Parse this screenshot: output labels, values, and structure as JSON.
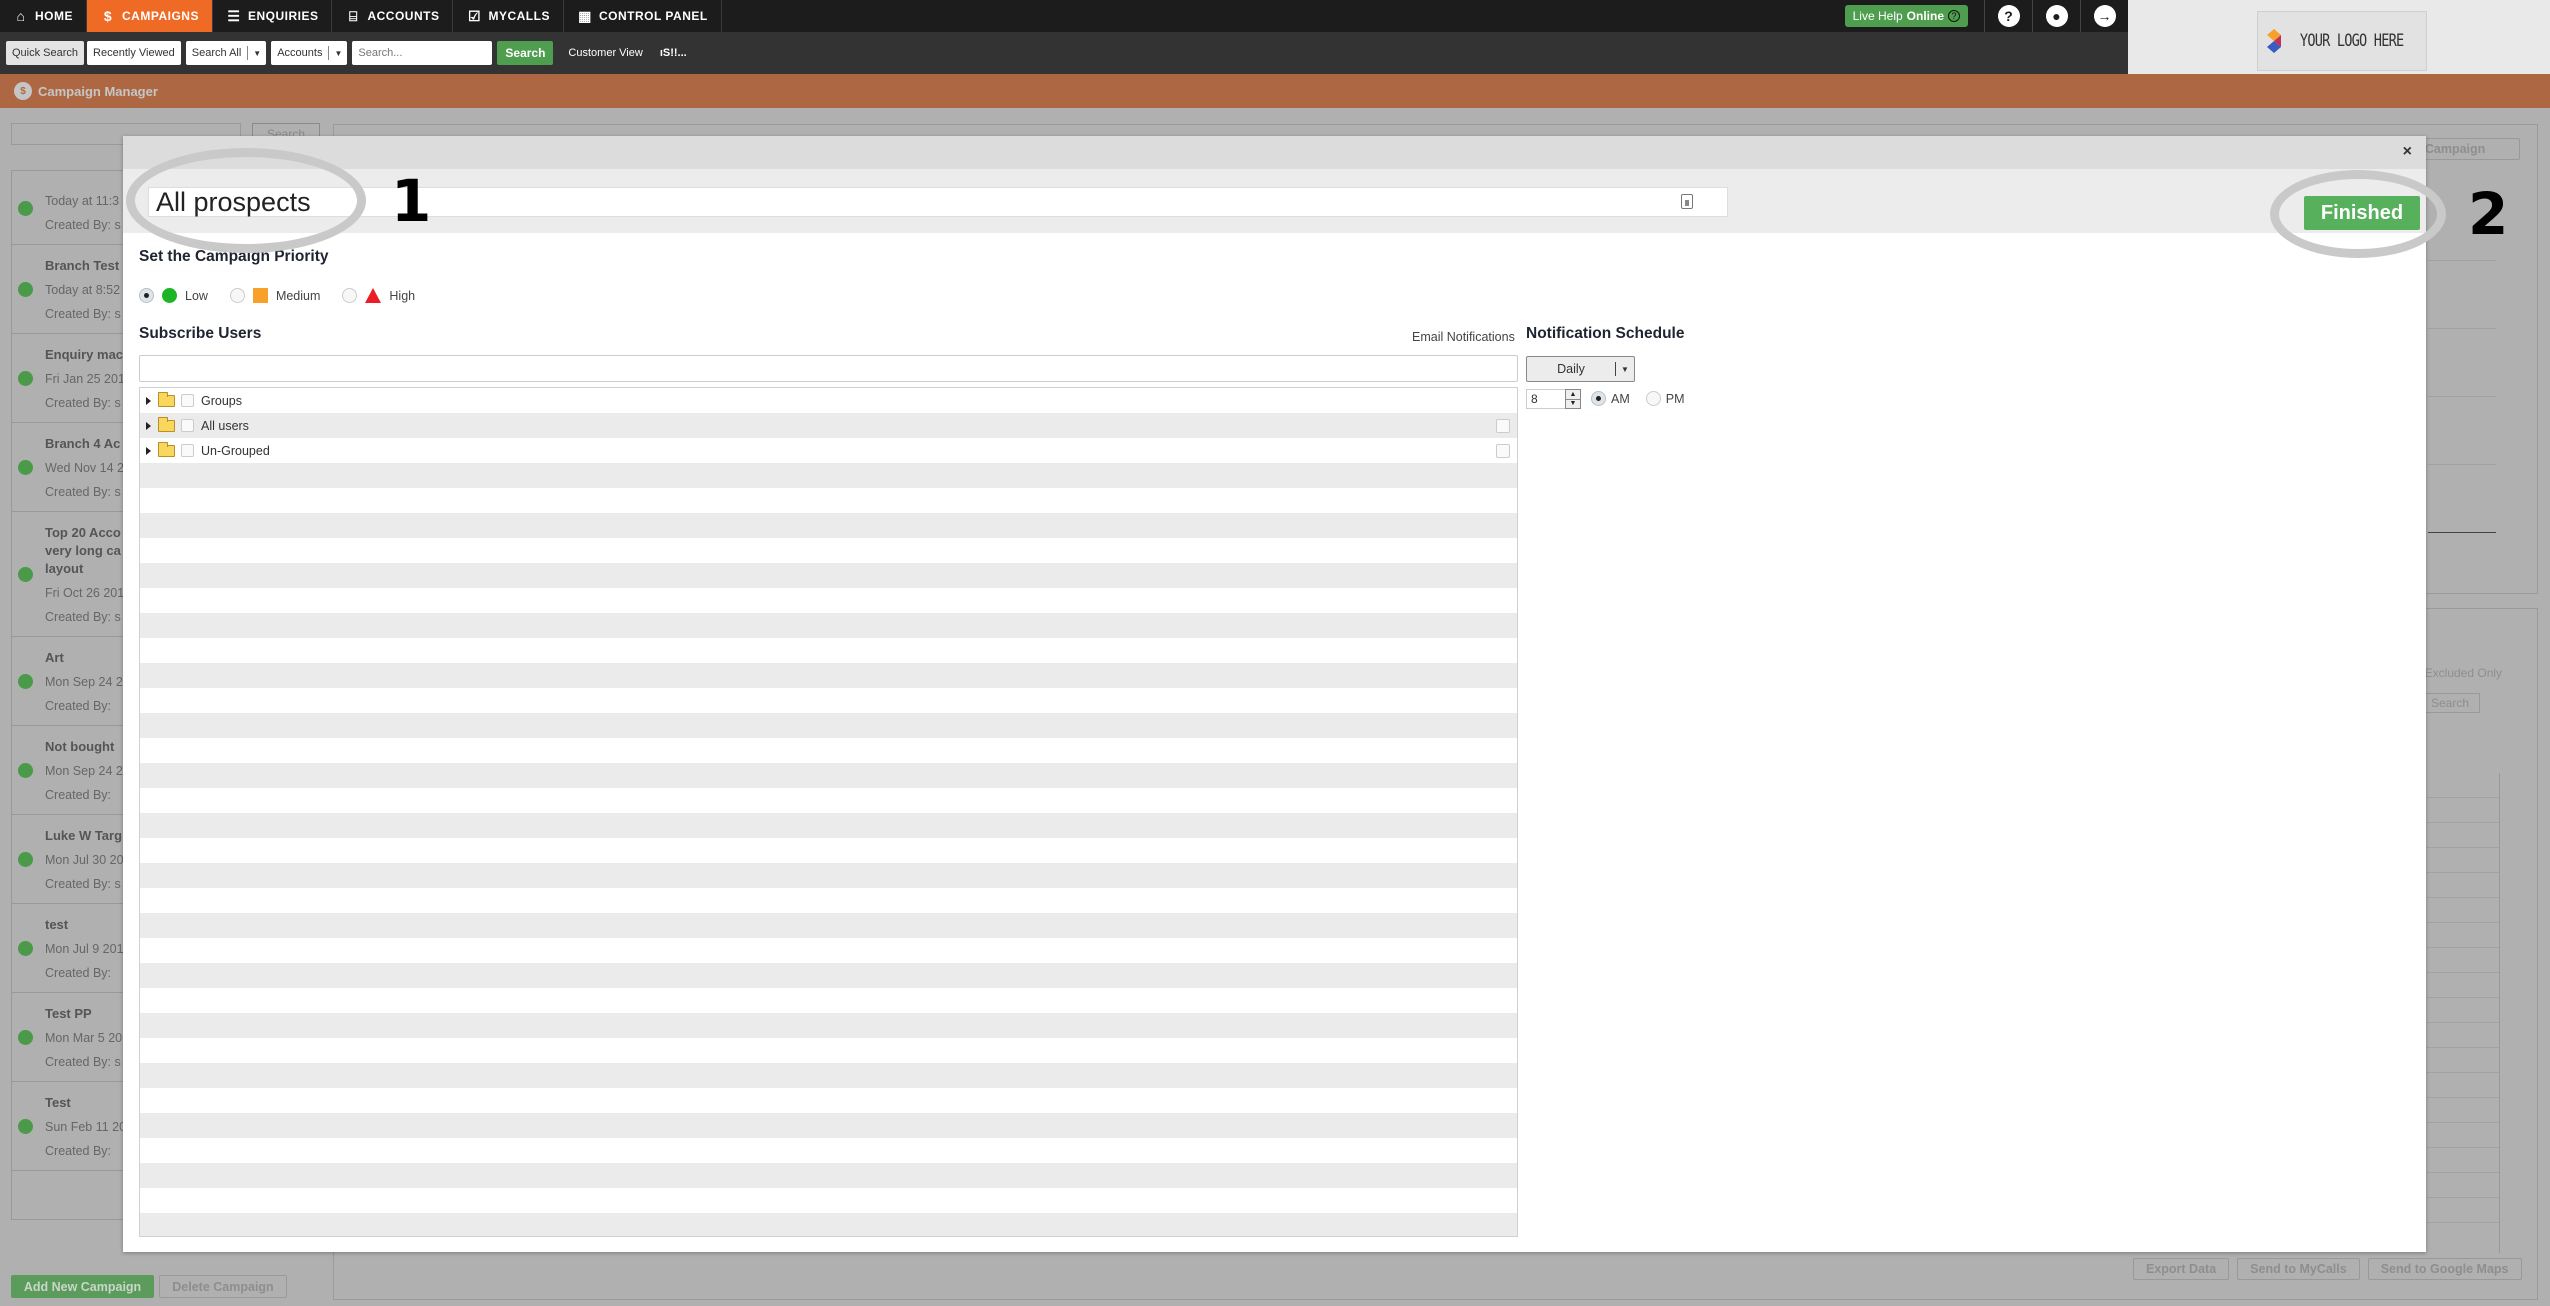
{
  "nav": {
    "items": [
      {
        "label": "HOME",
        "icon": "home-icon",
        "active": false
      },
      {
        "label": "CAMPAIGNS",
        "icon": "campaigns-icon",
        "active": true
      },
      {
        "label": "ENQUIRIES",
        "icon": "enquiries-icon",
        "active": false
      },
      {
        "label": "ACCOUNTS",
        "icon": "accounts-icon",
        "active": false
      },
      {
        "label": "MYCALLS",
        "icon": "mycalls-icon",
        "active": false
      },
      {
        "label": "CONTROL PANEL",
        "icon": "control-panel-icon",
        "active": false
      }
    ],
    "live_help_prefix": "Live Help",
    "live_help_status": "Online",
    "help_icon": "?",
    "user_icon": "user-icon",
    "logout_icon": "→"
  },
  "searchbar": {
    "quick_search": "Quick Search",
    "recently_viewed": "Recently Viewed",
    "scope_select": "Search All",
    "type_select": "Accounts",
    "search_placeholder": "Search...",
    "search_button": "Search",
    "customer_view": "Customer View",
    "extra_link": "ıS!!..."
  },
  "logo": {
    "text": "YOUR LOGO HERE"
  },
  "header": {
    "title": "Campaign Manager"
  },
  "background": {
    "search_button": "Search",
    "campaigns": [
      {
        "name": "",
        "date": "Today at 11:3",
        "created_by": "Created By: s"
      },
      {
        "name": "Branch Test",
        "date": "Today at 8:52",
        "created_by": "Created By: s"
      },
      {
        "name": "Enquiry mac",
        "date": "Fri Jan 25 201",
        "created_by": "Created By: s"
      },
      {
        "name": "Branch 4 Ac",
        "date": "Wed Nov 14 2",
        "created_by": "Created By: s"
      },
      {
        "name": "Top 20 Acco very long ca layout",
        "date": "Fri Oct 26 201",
        "created_by": "Created By: s"
      },
      {
        "name": "Art",
        "date": "Mon Sep 24 2",
        "created_by": "Created By:"
      },
      {
        "name": "Not bought",
        "date": "Mon Sep 24 2",
        "created_by": "Created By:"
      },
      {
        "name": "Luke W Targ",
        "date": "Mon Jul 30 20",
        "created_by": "Created By: s"
      },
      {
        "name": "test",
        "date": "Mon Jul 9 201",
        "created_by": "Created By:"
      },
      {
        "name": "Test PP",
        "date": "Mon Mar 5 20",
        "created_by": "Created By: s"
      },
      {
        "name": "Test",
        "date": "Sun Feb 11 20",
        "created_by": "Created By:"
      }
    ],
    "add_campaign": "Add New Campaign",
    "delete_campaign": "Delete Campaign",
    "new_campaign": "ew Campaign",
    "excluded_only": "/ Excluded Only",
    "search2": "Search",
    "export_data": "Export Data",
    "send_mycalls": "Send to MyCalls",
    "send_maps": "Send to Google Maps"
  },
  "modal": {
    "close_icon": "×",
    "campaign_name": "All prospects",
    "finished_button": "Finished",
    "annotation_1": "1",
    "annotation_2": "2",
    "priority_heading": "Set the Campaign Priority",
    "priority_options": [
      {
        "label": "Low",
        "selected": true,
        "color": "#1db525"
      },
      {
        "label": "Medium",
        "selected": false,
        "color": "#f7a12c"
      },
      {
        "label": "High",
        "selected": false,
        "color": "#ec1c24"
      }
    ],
    "subscribe_heading": "Subscribe Users",
    "email_notifications": "Email Notifications",
    "user_filter_value": "",
    "tree": [
      {
        "label": "Groups",
        "email_checkbox": false
      },
      {
        "label": "All users",
        "email_checkbox": true
      },
      {
        "label": "Un-Grouped",
        "email_checkbox": true
      }
    ],
    "schedule_heading": "Notification Schedule",
    "frequency": "Daily",
    "hour": "8",
    "am_label": "AM",
    "pm_label": "PM",
    "am_selected": true
  },
  "colors": {
    "nav_active": "#ef6a25",
    "header_band": "#ad6843",
    "finished_green": "#56b05c",
    "live_help_green": "#4f9e4f"
  }
}
